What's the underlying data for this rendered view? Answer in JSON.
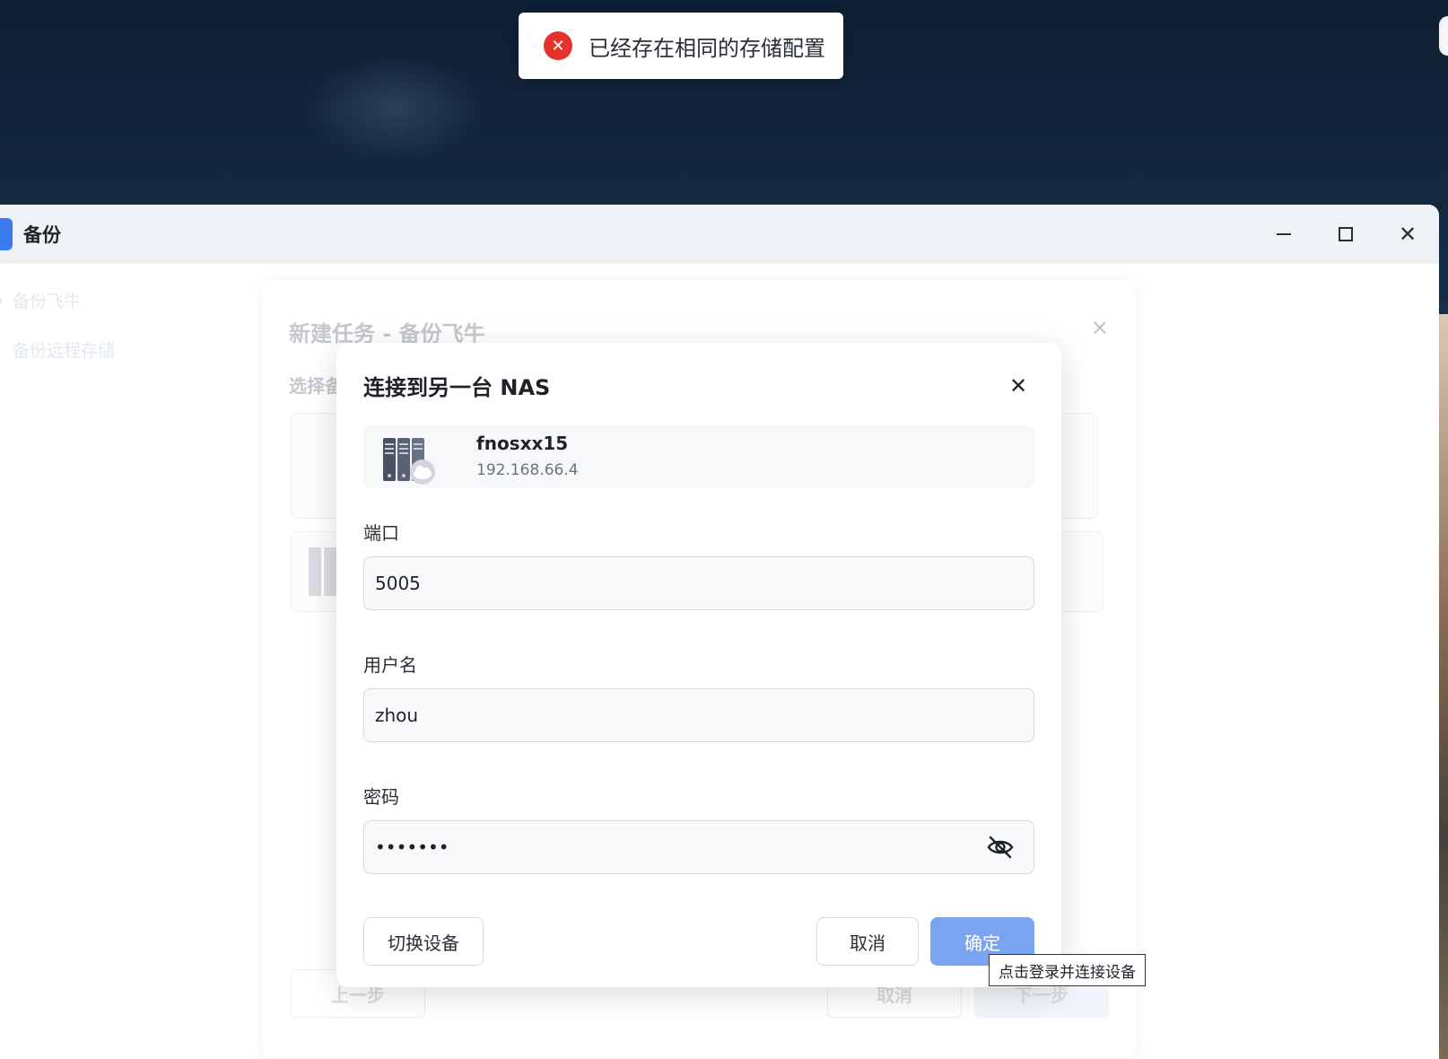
{
  "toast": {
    "message": "已经存在相同的存储配置",
    "icon": "error-circle-icon",
    "color": "#e5322d"
  },
  "window": {
    "title": "备份",
    "controls": {
      "minimize": "minimize-icon",
      "maximize": "maximize-icon",
      "close": "close-icon"
    }
  },
  "sidebar": {
    "items": [
      {
        "label": "备份飞牛"
      },
      {
        "label": "备份远程存储"
      }
    ]
  },
  "background_dialog": {
    "title": "新建任务 - 备份飞牛",
    "section_label": "选择备",
    "prev_label": "上一步",
    "cancel_label": "取消",
    "next_label": "下一步"
  },
  "modal": {
    "title": "连接到另一台 NAS",
    "device": {
      "name": "fnosxx15",
      "ip": "192.168.66.4",
      "icon": "nas-server-icon"
    },
    "port": {
      "label": "端口",
      "value": "5005"
    },
    "username": {
      "label": "用户名",
      "value": "zhou"
    },
    "password": {
      "label": "密码",
      "value": "•••••••",
      "toggle_icon": "eye-off-icon"
    },
    "switch_device_label": "切换设备",
    "cancel_label": "取消",
    "confirm_label": "确定",
    "accent_color": "#7aa3f0"
  },
  "tooltip": {
    "text": "点击登录并连接设备"
  }
}
